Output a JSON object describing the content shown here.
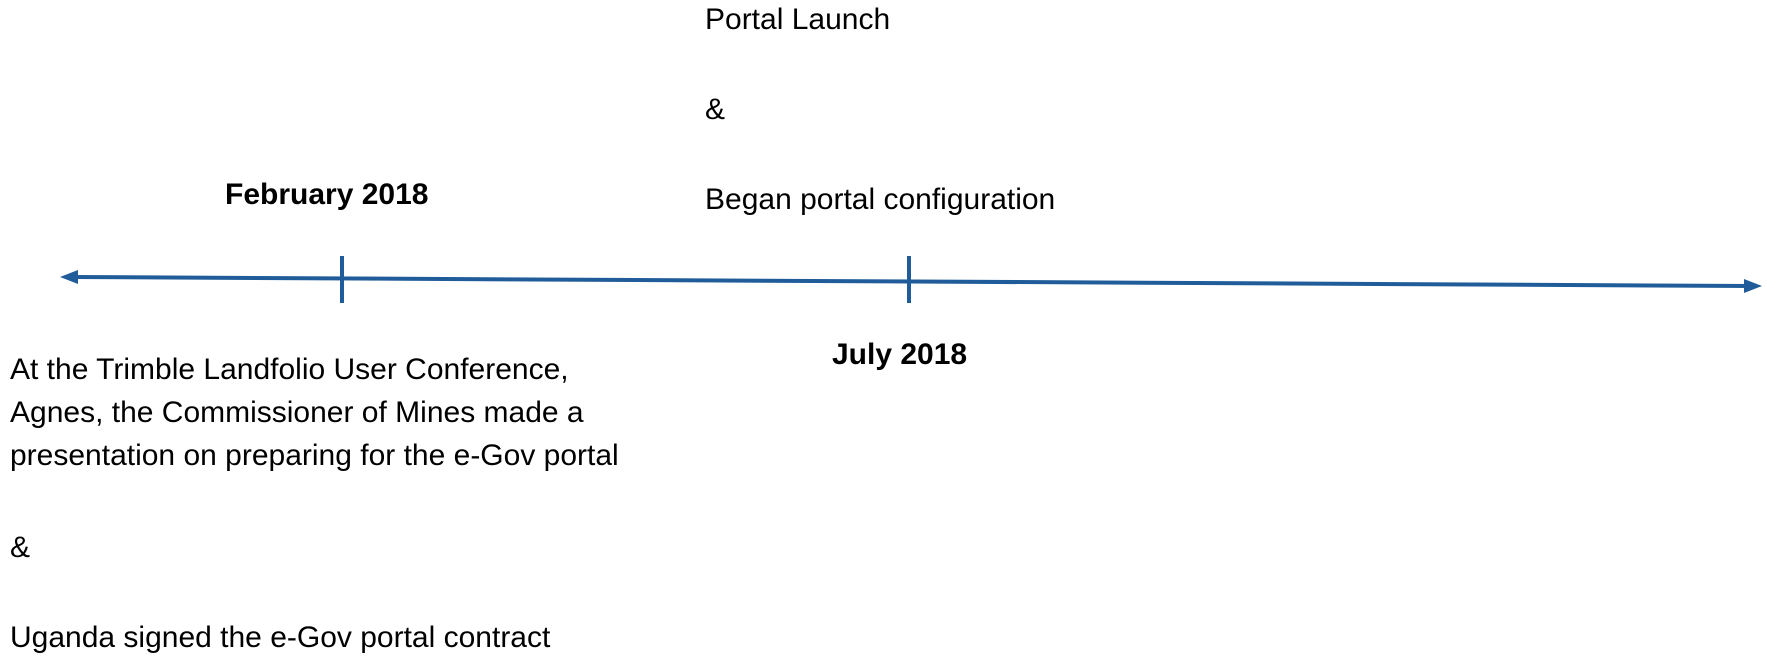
{
  "colors": {
    "timeline": "#1f5c99",
    "text": "#000000"
  },
  "events": {
    "february": {
      "date": "February 2018",
      "lines": [
        "At the Trimble Landfolio User Conference,",
        "Agnes, the Commissioner of Mines made a",
        "presentation on preparing for the e-Gov portal",
        "&",
        "Uganda signed the e-Gov portal contract"
      ]
    },
    "july": {
      "date": "July 2018",
      "lines": [
        "Portal Launch",
        "&",
        "Began portal configuration"
      ]
    }
  }
}
